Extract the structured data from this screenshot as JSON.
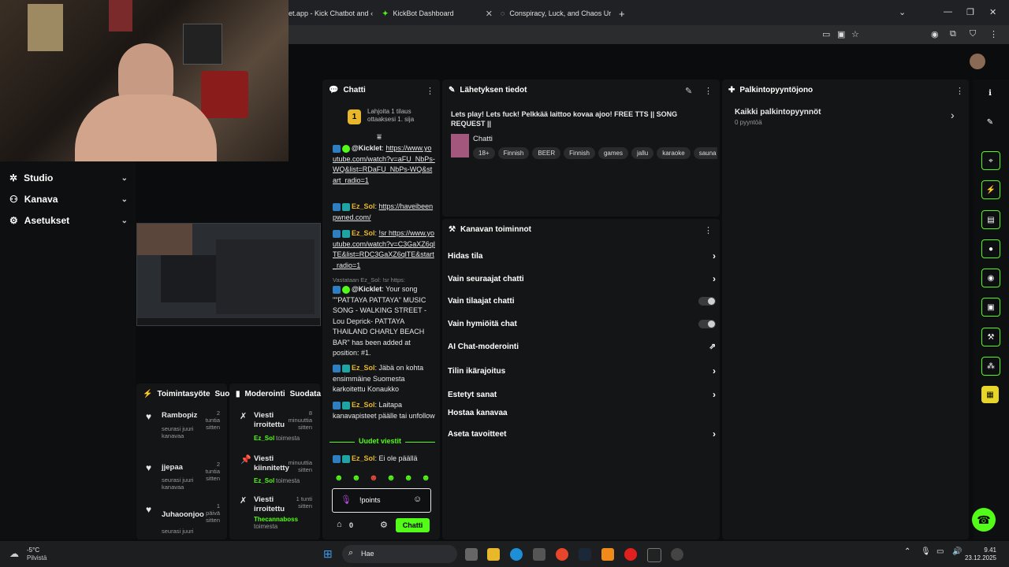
{
  "browser": {
    "tabs": [
      {
        "label": "et.app - Kick Chatbot and ‹"
      },
      {
        "label": "KickBot Dashboard"
      },
      {
        "label": "Conspiracy, Luck, and Chaos Ur"
      }
    ],
    "new_tab": "+"
  },
  "nav": {
    "items": [
      {
        "label": "Studio"
      },
      {
        "label": "Kanava"
      },
      {
        "label": "Asetukset"
      }
    ]
  },
  "chat": {
    "title": "Chatti",
    "pinned_badge": "1",
    "pinned_text": "Lahjoita 1 tilaus ottaaksesi 1. sija",
    "messages": [
      {
        "user": "@Kicklet",
        "text": "https://www.youtube.com/watch?v=aFU_NbPs-WQ&list=RDaFU_NbPs-WQ&start_radio=1"
      },
      {
        "user": "Ez_Sol",
        "text": "https://haveibeenpwned.com/"
      },
      {
        "user": "Ez_Sol",
        "text": "!sr https://www.youtube.com/watch?v=C3GaXZ6qlTE&list=RDC3GaXZ6qlTE&start_radio=1"
      },
      {
        "reply": "Vastataan Ez_Sol: !sr https:"
      },
      {
        "user": "@Kicklet",
        "text": "Your song \"\"PATTAYA PATTAYA\" MUSIC SONG - WALKING STREET - Lou Deprick- PATTAYA THAILAND CHARLY BEACH BAR\" has been added at position: #1."
      },
      {
        "user": "Ez_Sol",
        "text": "Jäbä on kohta ensimmäine Suomesta karkoitettu Konaukko"
      },
      {
        "user": "Ez_Sol",
        "text": "Laitapa kanavapisteet päälle tai unfollow"
      },
      {
        "user": "Ez_Sol",
        "text": "Ei ole päällä"
      }
    ],
    "new_messages": "Uudet viestit",
    "input_value": "!points",
    "points": "0",
    "send_label": "Chatti"
  },
  "stream_info": {
    "title": "Lähetyksen tiedot",
    "stream_title": "Lets play! Lets fuck! Pelkkää laittoo kovaa ajoo! FREE TTS || SONG REQUEST ||",
    "category": "Chatti",
    "tags": [
      "18+",
      "Finnish",
      "BEER",
      "Finnish",
      "games",
      "jallu",
      "karaoke",
      "sauna"
    ]
  },
  "channel_actions": {
    "title": "Kanavan toiminnot",
    "items": [
      {
        "label": "Hidas tila"
      },
      {
        "label": "Vain seuraajat chatti"
      },
      {
        "label": "Vain tilaajat chatti"
      },
      {
        "label": "Vain hymiöitä chat"
      },
      {
        "label": "AI Chat-moderointi"
      },
      {
        "label": "Tilin ikärajoitus"
      },
      {
        "label": "Estetyt sanat"
      },
      {
        "label": "Hostaa kanavaa"
      },
      {
        "label": "Aseta tavoitteet"
      }
    ]
  },
  "rewards": {
    "title": "Palkintopyyntöjono",
    "all_label": "Kaikki palkintopyynnöt",
    "count_label": "0 pyyntöä"
  },
  "activity": {
    "title": "Toimintasyöte",
    "title2": "Suod",
    "rows": [
      {
        "name": "Rambopiz",
        "time": "2 tuntia sitten",
        "action": "seurasi juuri kanavaa"
      },
      {
        "name": "jjepaa",
        "time": "2 tuntia sitten",
        "action": "seurasi juuri kanavaa"
      },
      {
        "name": "Juhaoonjoo",
        "time": "1 päivä sitten",
        "action": "seurasi juuri"
      }
    ]
  },
  "moderation": {
    "title": "Moderointi",
    "title2": "Suodata",
    "rows": [
      {
        "action": "Viesti irroitettu",
        "time": "8 minuuttia sitten",
        "by": "Ez_Sol",
        "suffix": "toimesta"
      },
      {
        "action": "Viesti kiinnitetty",
        "time": "minuuttia sitten",
        "by": "Ez_Sol",
        "suffix": "toimesta"
      },
      {
        "action": "Viesti irroitettu",
        "time": "1 tunti sitten",
        "by": "Thecannaboss",
        "suffix": "toimesta"
      }
    ]
  },
  "taskbar": {
    "weather_temp": "-5°C",
    "weather_desc": "Pilvistä",
    "search": "Hae",
    "time": "9.41",
    "date": "23.12.2025"
  },
  "colors": {
    "accent": "#53fc18",
    "panel": "#141516"
  }
}
